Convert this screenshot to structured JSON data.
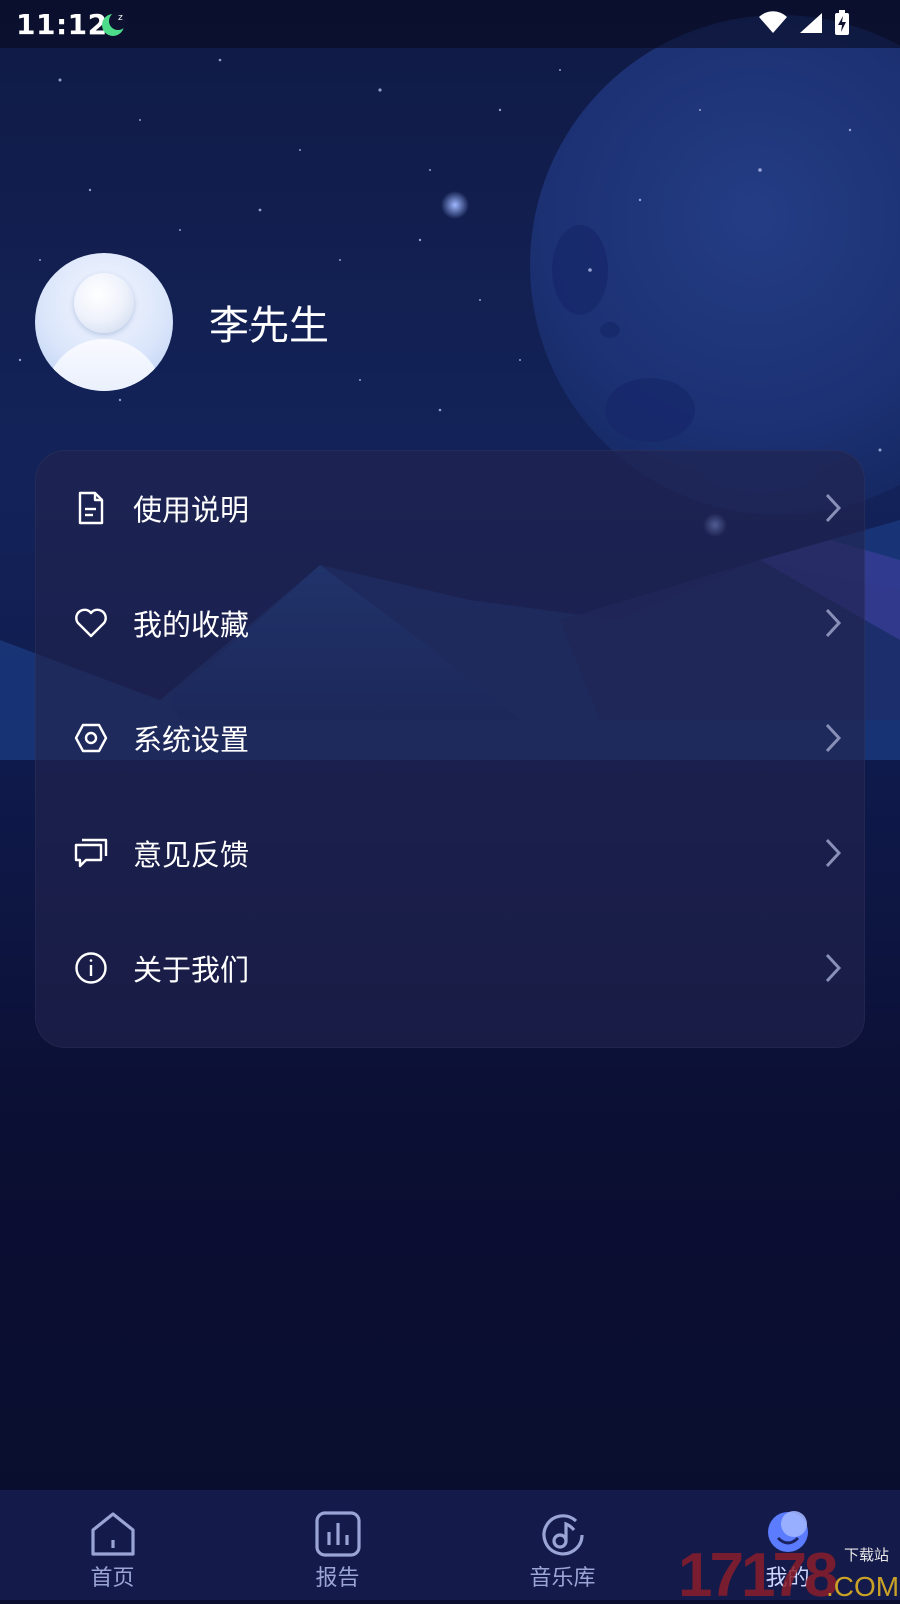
{
  "status_bar": {
    "time": "11:12",
    "moon_badge": "z"
  },
  "profile": {
    "username": "李先生"
  },
  "menu": {
    "items": [
      {
        "label": "使用说明",
        "icon": "document-icon"
      },
      {
        "label": "我的收藏",
        "icon": "heart-icon"
      },
      {
        "label": "系统设置",
        "icon": "settings-hexagon-icon"
      },
      {
        "label": "意见反馈",
        "icon": "chat-bubble-icon"
      },
      {
        "label": "关于我们",
        "icon": "info-icon"
      }
    ]
  },
  "tabbar": {
    "tabs": [
      {
        "label": "首页",
        "icon": "home-icon"
      },
      {
        "label": "报告",
        "icon": "bar-chart-icon"
      },
      {
        "label": "音乐库",
        "icon": "music-note-icon"
      },
      {
        "label": "我的",
        "icon": "profile-moon-icon"
      }
    ],
    "active_index": 3
  },
  "watermark": {
    "number": "17178",
    "small": "下载站",
    "suffix": ".COM"
  },
  "colors": {
    "accent": "#5b7cff",
    "card": "#22244e",
    "tabbar": "#141a4a"
  }
}
